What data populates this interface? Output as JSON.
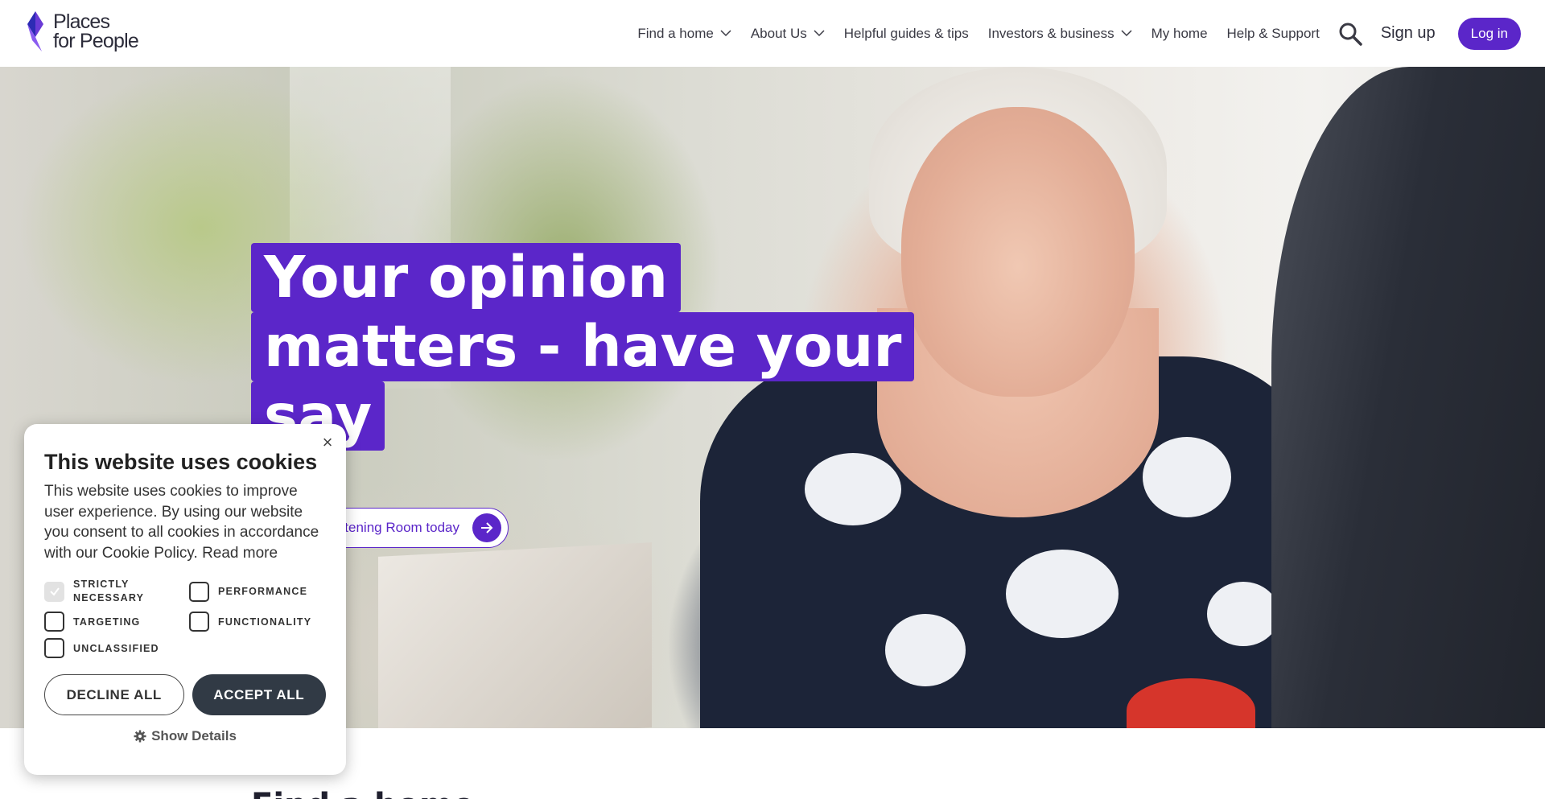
{
  "header": {
    "logo": {
      "line1": "Places",
      "line2": "for People"
    },
    "nav": [
      {
        "label": "Find a home",
        "has_dropdown": true
      },
      {
        "label": "About Us",
        "has_dropdown": true
      },
      {
        "label": "Helpful guides & tips",
        "has_dropdown": false
      },
      {
        "label": "Investors & business",
        "has_dropdown": true
      },
      {
        "label": "My home",
        "has_dropdown": false
      },
      {
        "label": "Help & Support",
        "has_dropdown": false
      }
    ],
    "search_icon": "search-icon",
    "signup_label": "Sign up",
    "login_label": "Log in"
  },
  "hero": {
    "headline_lines": [
      "Your opinion",
      "matters - have your",
      "say"
    ],
    "cta_label": "tening Room today",
    "cta_icon": "arrow-right-icon"
  },
  "below_title": "Find a home",
  "cookie": {
    "title": "This website uses cookies",
    "body": "This website uses cookies to improve user experience. By using our website you consent to all cookies in accordance with our Cookie Policy.",
    "read_more": "Read more",
    "options": [
      {
        "label": "STRICTLY NECESSARY",
        "checked": true
      },
      {
        "label": "PERFORMANCE",
        "checked": false
      },
      {
        "label": "TARGETING",
        "checked": false
      },
      {
        "label": "FUNCTIONALITY",
        "checked": false
      },
      {
        "label": "UNCLASSIFIED",
        "checked": false
      }
    ],
    "decline_label": "DECLINE ALL",
    "accept_label": "ACCEPT ALL",
    "show_details_label": "Show Details",
    "close_symbol": "×"
  },
  "colors": {
    "brand_purple": "#5b26c9",
    "accept_button": "#313a45"
  }
}
